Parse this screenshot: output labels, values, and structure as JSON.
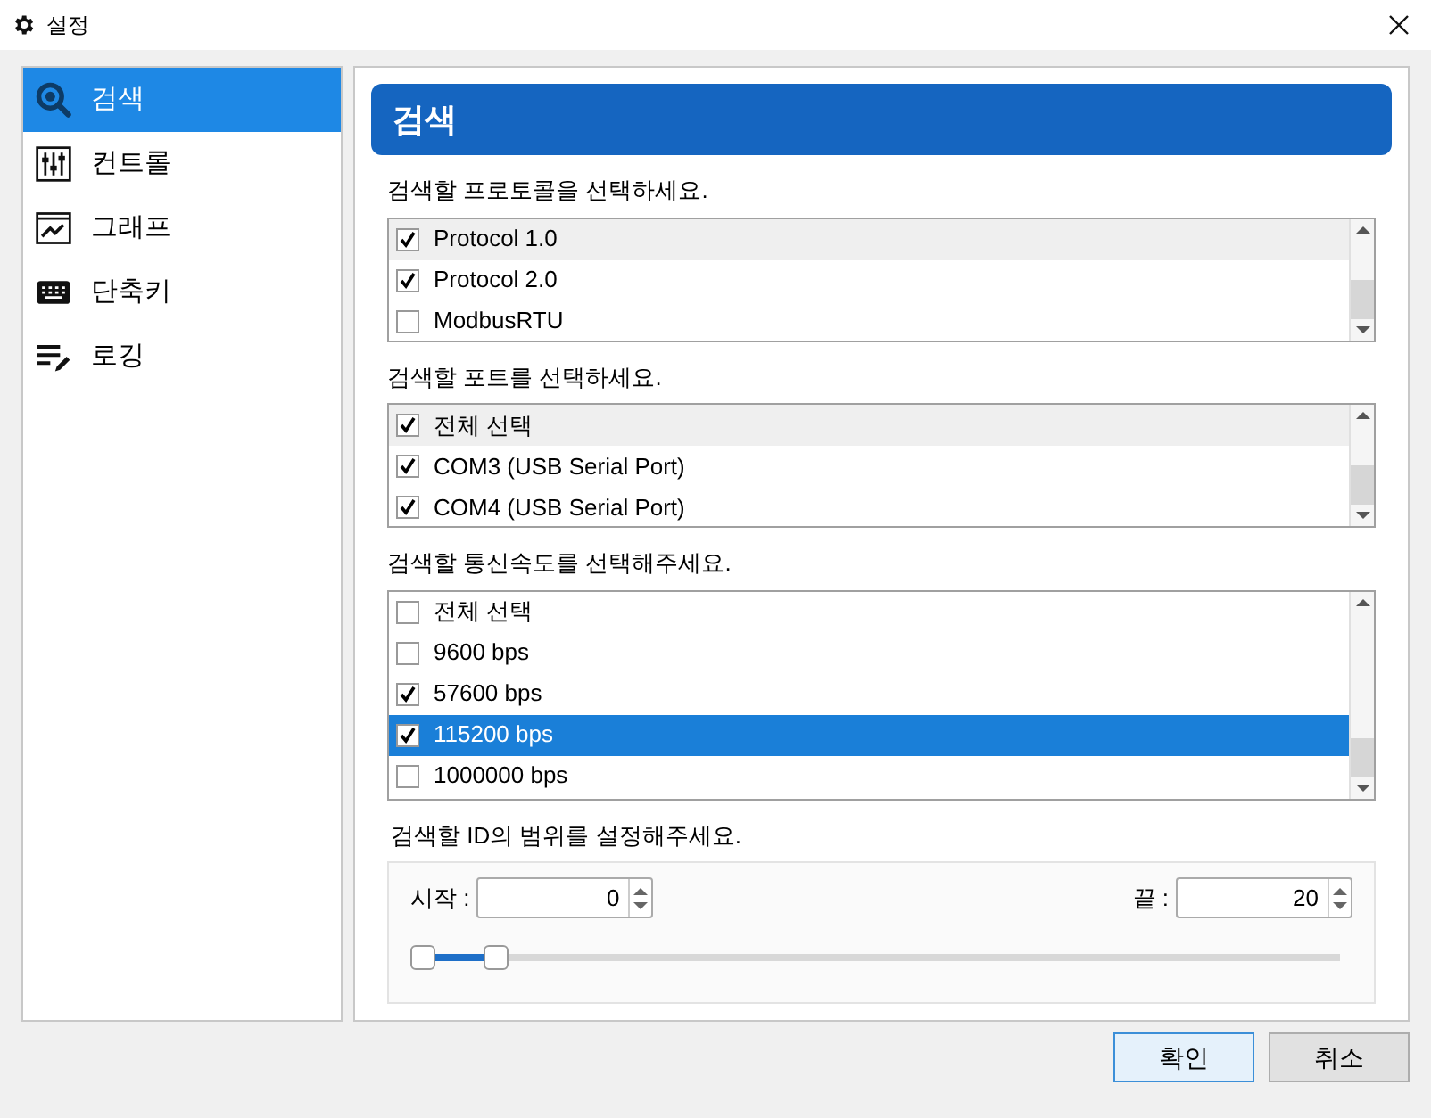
{
  "window": {
    "title": "설정"
  },
  "sidebar": {
    "items": [
      {
        "label": "검색",
        "selected": true
      },
      {
        "label": "컨트롤",
        "selected": false
      },
      {
        "label": "그래프",
        "selected": false
      },
      {
        "label": "단축키",
        "selected": false
      },
      {
        "label": "로깅",
        "selected": false
      }
    ]
  },
  "panel": {
    "title": "검색",
    "lists": [
      {
        "label": "검색할 프로토콜을 선택하세요.",
        "items": [
          {
            "text": "Protocol 1.0",
            "checked": true,
            "hovered": true,
            "selected": false
          },
          {
            "text": "Protocol 2.0",
            "checked": true,
            "hovered": false,
            "selected": false
          },
          {
            "text": "ModbusRTU",
            "checked": false,
            "hovered": false,
            "selected": false
          }
        ]
      },
      {
        "label": "검색할 포트를 선택하세요.",
        "items": [
          {
            "text": "전체 선택",
            "checked": true,
            "hovered": true,
            "selected": false
          },
          {
            "text": "COM3 (USB Serial Port)",
            "checked": true,
            "hovered": false,
            "selected": false
          },
          {
            "text": "COM4 (USB Serial Port)",
            "checked": true,
            "hovered": false,
            "selected": false
          }
        ]
      },
      {
        "label": "검색할 통신속도를 선택해주세요.",
        "items": [
          {
            "text": "전체 선택",
            "checked": false,
            "hovered": false,
            "selected": false
          },
          {
            "text": "9600 bps",
            "checked": false,
            "hovered": false,
            "selected": false
          },
          {
            "text": "57600 bps",
            "checked": true,
            "hovered": false,
            "selected": false
          },
          {
            "text": "115200 bps",
            "checked": true,
            "hovered": false,
            "selected": true
          },
          {
            "text": "1000000 bps",
            "checked": false,
            "hovered": false,
            "selected": false
          }
        ]
      }
    ],
    "range": {
      "label": "검색할 ID의 범위를 설정해주세요.",
      "start_label": "시작 :",
      "start_value": "0",
      "end_label": "끝 :",
      "end_value": "20",
      "thumbs": [
        {
          "level": 0
        },
        {
          "level": 0.08
        }
      ]
    }
  },
  "buttons": [
    {
      "label": "확인",
      "default": true
    },
    {
      "label": "취소",
      "default": false
    }
  ]
}
